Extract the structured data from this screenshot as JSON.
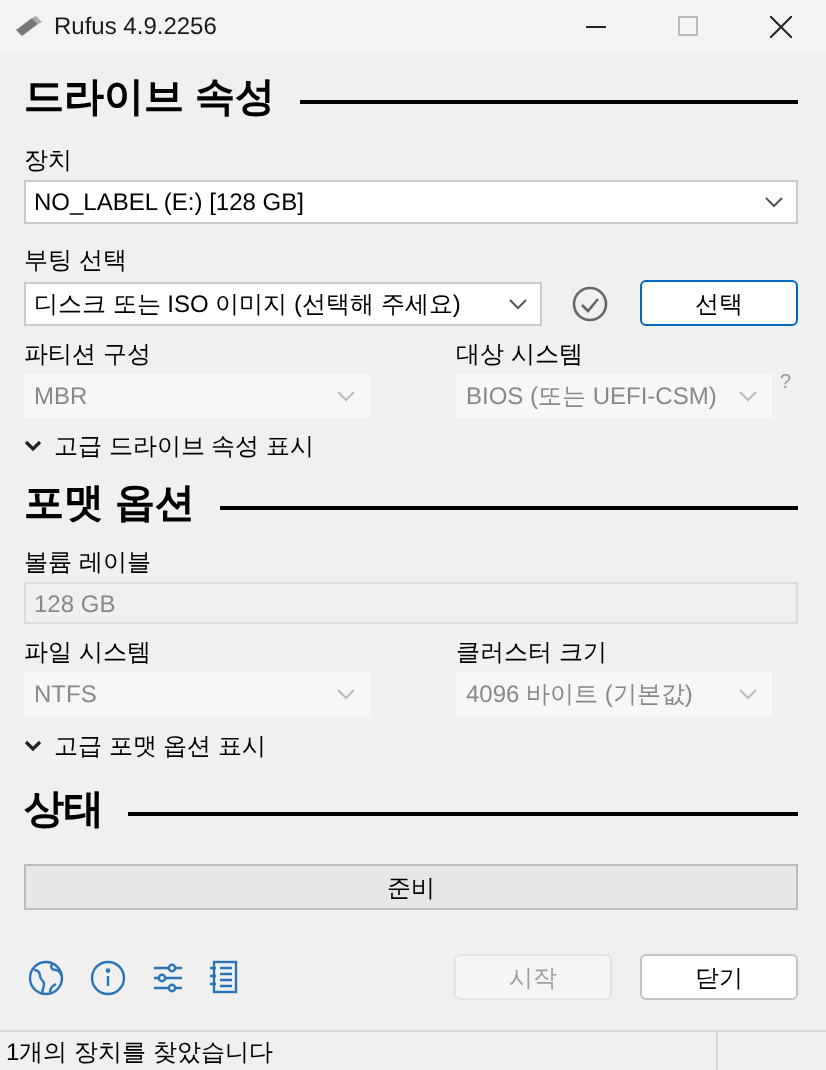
{
  "window": {
    "title": "Rufus 4.9.2256"
  },
  "drive_properties": {
    "heading": "드라이브 속성",
    "device": {
      "label": "장치",
      "value": "NO_LABEL (E:) [128 GB]",
      "disabled": false
    },
    "boot_selection": {
      "label": "부팅 선택",
      "value": "디스크 또는 ISO 이미지 (선택해 주세요)",
      "disabled": false,
      "select_button": "선택"
    },
    "partition_scheme": {
      "label": "파티션 구성",
      "value": "MBR",
      "disabled": true
    },
    "target_system": {
      "label": "대상 시스템",
      "value": "BIOS (또는 UEFI-CSM)",
      "disabled": true,
      "help": "?"
    },
    "advanced": {
      "label": "고급 드라이브 속성 표시",
      "expanded": false
    }
  },
  "format_options": {
    "heading": "포맷 옵션",
    "volume_label": {
      "label": "볼륨 레이블",
      "value": "128 GB",
      "disabled": true
    },
    "file_system": {
      "label": "파일 시스템",
      "value": "NTFS",
      "disabled": true
    },
    "cluster_size": {
      "label": "클러스터 크기",
      "value": "4096 바이트 (기본값)",
      "disabled": true
    },
    "advanced": {
      "label": "고급 포맷 옵션 표시",
      "expanded": false
    }
  },
  "status": {
    "heading": "상태",
    "progress_text": "준비"
  },
  "buttons": [
    {
      "label": "시작",
      "disabled": true
    },
    {
      "label": "닫기",
      "disabled": false
    }
  ],
  "status_bar": {
    "text": "1개의 장치를 찾았습니다"
  }
}
